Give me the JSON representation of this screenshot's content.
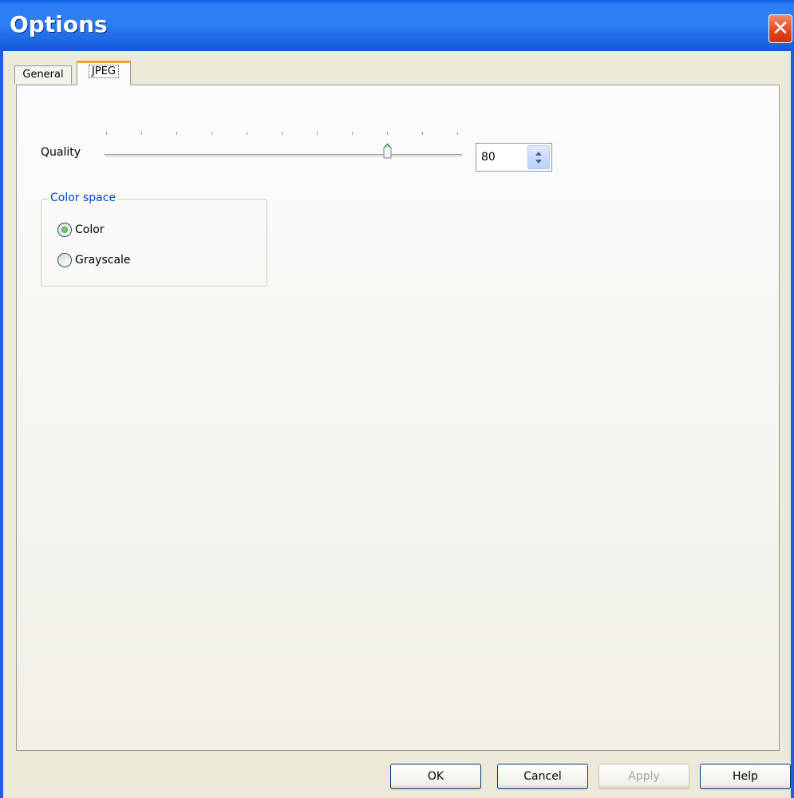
{
  "window": {
    "title": "Options",
    "close_icon": "close-icon"
  },
  "tabs": [
    {
      "label": "General",
      "selected": false
    },
    {
      "label": "JPEG",
      "selected": true
    }
  ],
  "quality": {
    "label": "Quality",
    "value": "80",
    "slider_min": 0,
    "slider_max": 100,
    "slider_value": 80,
    "tick_count": 11
  },
  "color_space": {
    "legend": "Color space",
    "options": [
      {
        "label": "Color",
        "checked": true
      },
      {
        "label": "Grayscale",
        "checked": false
      }
    ]
  },
  "buttons": {
    "ok": "OK",
    "cancel": "Cancel",
    "apply": "Apply",
    "help": "Help"
  },
  "colors": {
    "titlebar": "#2f7ff4",
    "close": "#e0451c",
    "legend_text": "#0046d5",
    "tab_highlight": "#f0a030"
  }
}
